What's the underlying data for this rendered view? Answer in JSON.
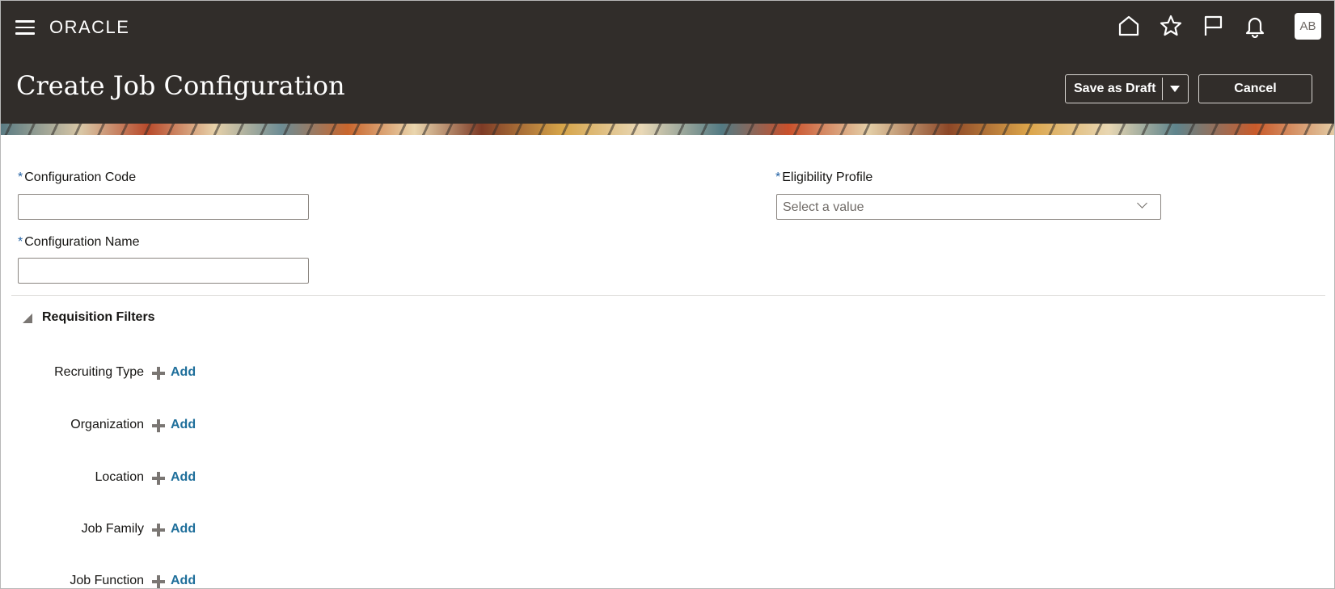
{
  "header": {
    "logo": "ORACLE",
    "avatar_initials": "AB",
    "icons": [
      "menu-icon",
      "home-icon",
      "star-icon",
      "flag-icon",
      "bell-icon"
    ]
  },
  "page": {
    "title": "Create Job Configuration",
    "actions": {
      "save_draft_label": "Save as Draft",
      "cancel_label": "Cancel"
    }
  },
  "form": {
    "required_marker": "*",
    "configuration_code": {
      "label": "Configuration Code",
      "value": ""
    },
    "configuration_name": {
      "label": "Configuration Name",
      "value": ""
    },
    "eligibility_profile": {
      "label": "Eligibility Profile",
      "placeholder": "Select a value"
    }
  },
  "requisition_filters": {
    "title": "Requisition Filters",
    "add_label": "Add",
    "filters": [
      {
        "label": "Recruiting Type"
      },
      {
        "label": "Organization"
      },
      {
        "label": "Location"
      },
      {
        "label": "Job Family"
      },
      {
        "label": "Job Function"
      }
    ]
  },
  "colors": {
    "header_bg": "#312d2a",
    "required_asterisk": "#2362a4",
    "link": "#1f6f9b"
  }
}
